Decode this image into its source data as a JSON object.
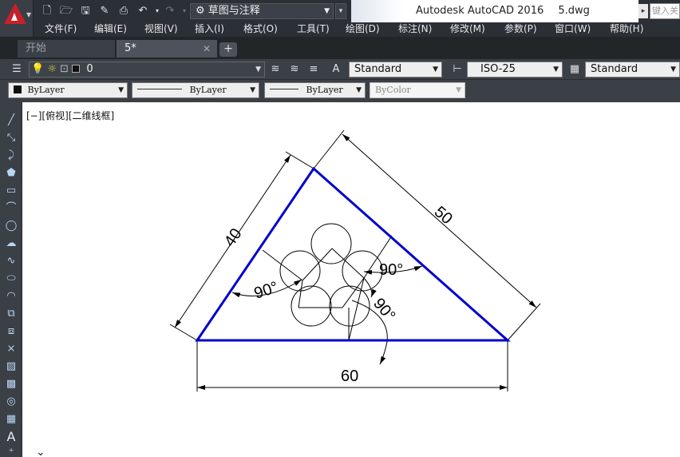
{
  "title_bar": {
    "workspace": "草图与注释",
    "app_title": "Autodesk AutoCAD 2016",
    "file_name": "5.dwg",
    "search_placeholder": "键入关"
  },
  "menu": [
    "文件(F)",
    "编辑(E)",
    "视图(V)",
    "插入(I)",
    "格式(O)",
    "工具(T)",
    "绘图(D)",
    "标注(N)",
    "修改(M)",
    "参数(P)",
    "窗口(W)",
    "帮助(H)"
  ],
  "tabs": [
    {
      "label": "开始",
      "active": false
    },
    {
      "label": "5*",
      "active": true
    }
  ],
  "layer_toolbar": {
    "layer": "0",
    "text_style": "Standard",
    "dim_style": "ISO-25",
    "table_style": "Standard"
  },
  "properties_toolbar": {
    "color": "ByLayer",
    "linetype": "ByLayer",
    "lineweight": "ByLayer",
    "plot_style": "ByColor"
  },
  "viewport_label": "[−][俯视][二维线框]",
  "drawing": {
    "dimensions": {
      "left_side": "40",
      "right_side": "50",
      "bottom": "60",
      "angle_left": "90°",
      "angle_right": "90°",
      "angle_bottom": "90°"
    },
    "triangle_color": "#0000cc",
    "line_color": "#000000"
  },
  "colors": {
    "ui_dark": "#3b3f46",
    "title_dark": "#2b2f36",
    "accent_red": "#c8202a"
  }
}
